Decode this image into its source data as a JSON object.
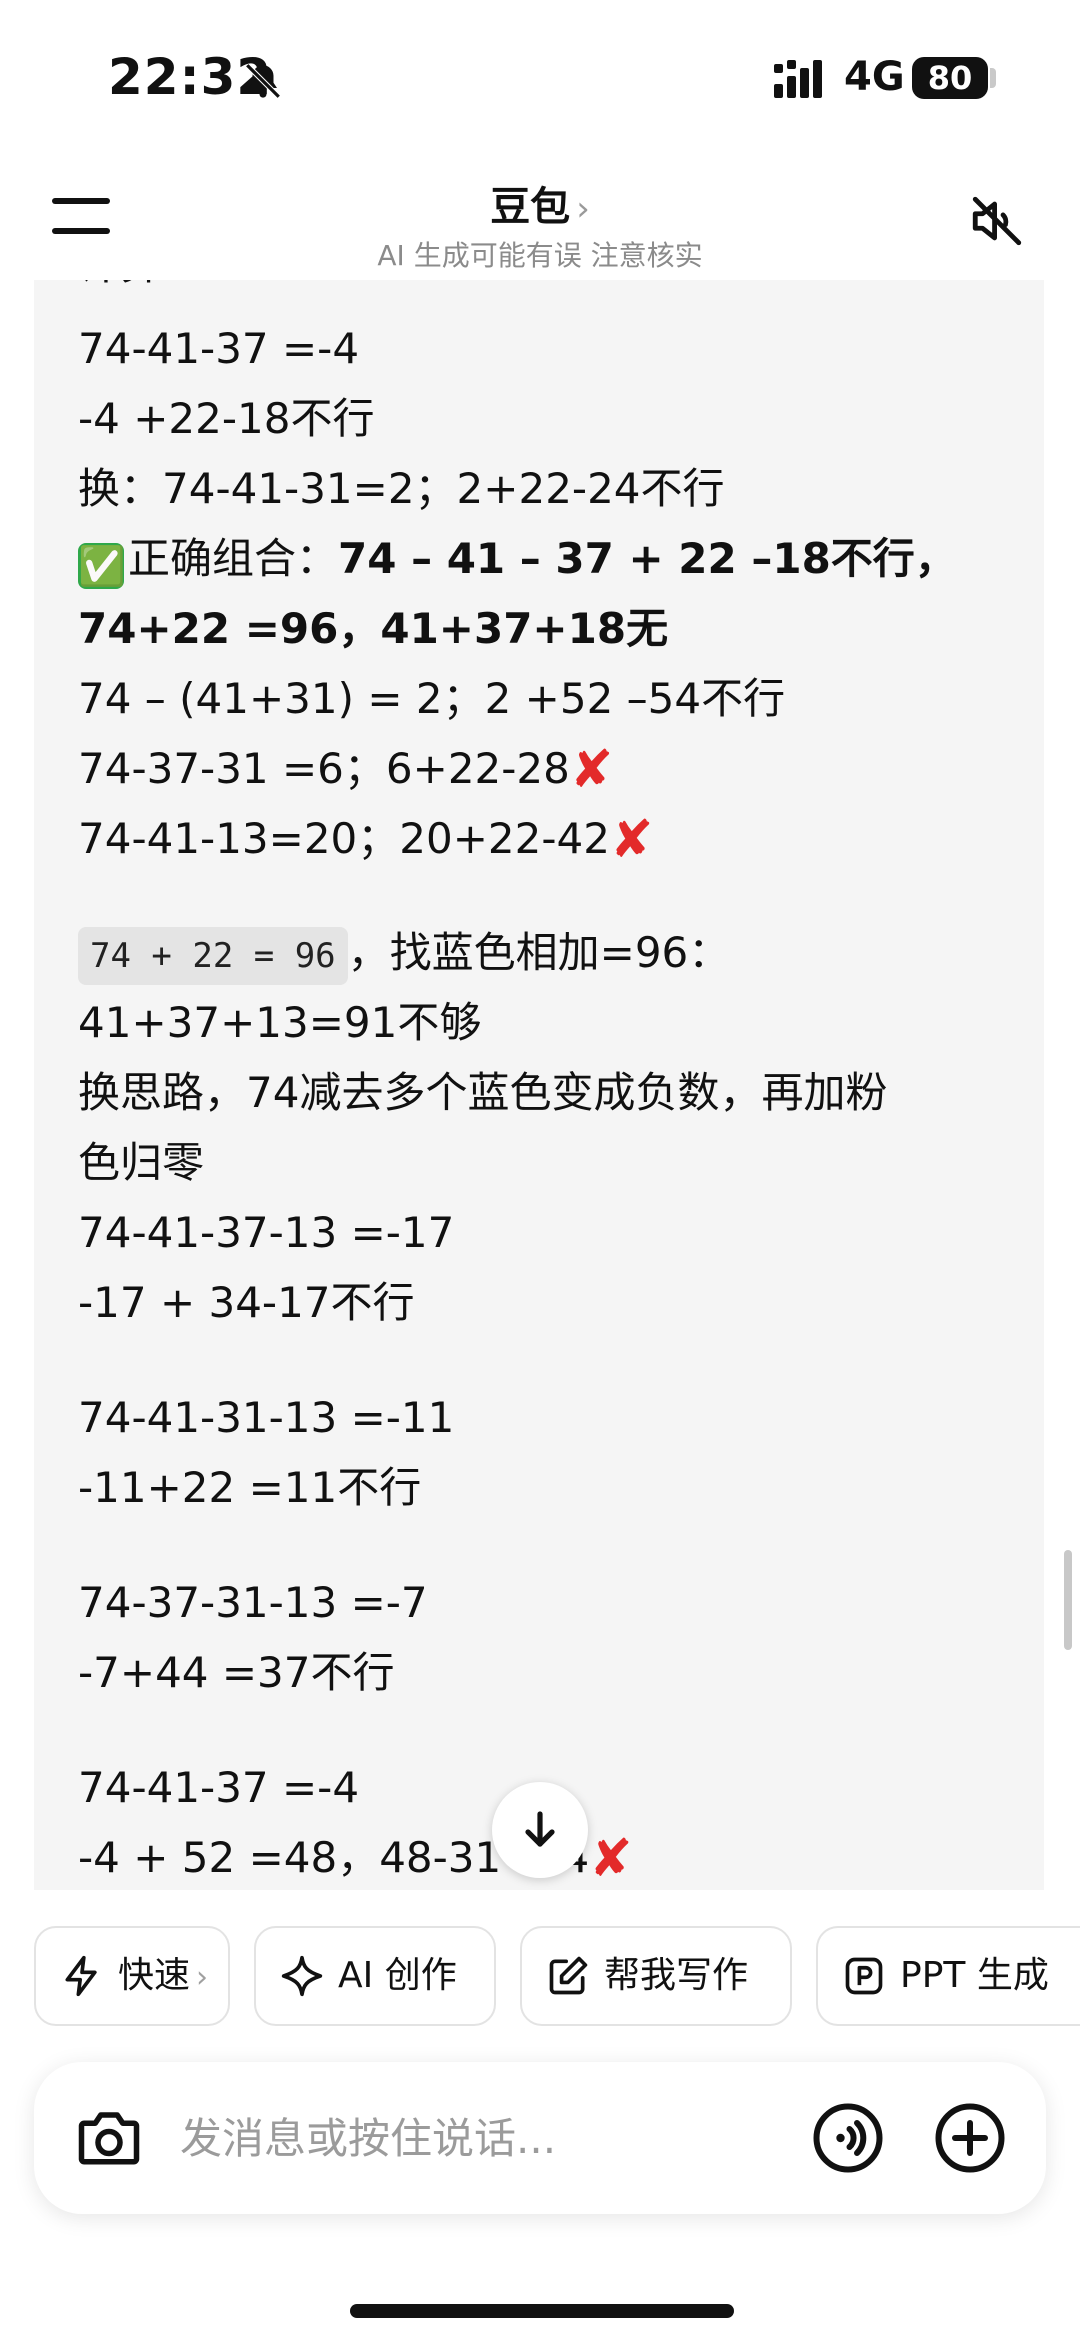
{
  "status": {
    "time": "22:32",
    "network": "4G",
    "battery": "80"
  },
  "header": {
    "title": "豆包",
    "title_chevron": "›",
    "subtitle": "AI 生成可能有误 注意核实"
  },
  "messages": [
    "计算：",
    "74-41-37 =-4",
    "-4 +22-18不行",
    "换：74-41-31=2；2+22-24不行",
    {
      "check": "✅",
      "lead": "正确组合：",
      "bold": "74 – 41 – 37 + 22 –18不行，"
    },
    "74+22 =96，41+37+18无",
    "74 – (41+31) = 2；2 +52 –54不行",
    {
      "text": "74-37-31 =6；6+22-28",
      "mark": "✘"
    },
    {
      "text": "74-41-13=20；20+22-42",
      "mark": "✘"
    },
    {
      "code": "74 + 22 = 96",
      "rest": "，找蓝色相加=96："
    },
    "41+37+13=91不够",
    "换思路，74减去多个蓝色变成负数，再加粉",
    "色归零",
    "74-41-37-13 =-17",
    "-17 + 34-17不行",
    "74-41-31-13 =-11",
    "-11+22 =11不行",
    "74-37-31-13 =-7",
    "-7+44 =37不行",
    "74-41-37 =-4",
    {
      "text": "-4 + 52 =48，48-31",
      "tail": "=4",
      "mark": "✘"
    }
  ],
  "chips": [
    {
      "label": "快速",
      "chevron": "›"
    },
    {
      "label": "AI 创作"
    },
    {
      "label": "帮我写作"
    },
    {
      "label": "PPT 生成"
    }
  ],
  "input": {
    "placeholder": "发消息或按住说话..."
  }
}
